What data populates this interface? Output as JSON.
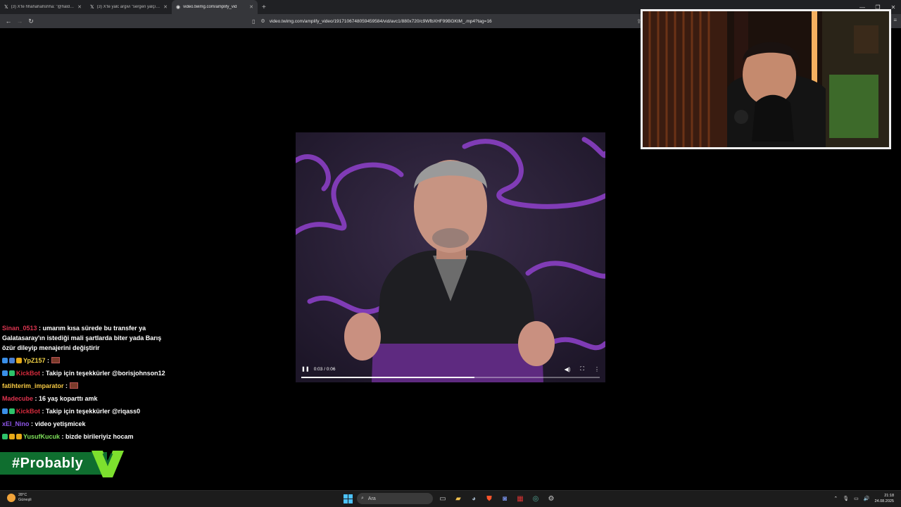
{
  "browser": {
    "tabs": [
      {
        "label": "(3) X'te hhahahahshha: \"@haldunsim",
        "icon": "x-logo-icon",
        "active": false
      },
      {
        "label": "(3) X'te yalc argivi \"sergen yalçın - bi",
        "icon": "x-logo-icon",
        "active": false
      },
      {
        "label": "video.twimg.com/amplify_vid",
        "icon": "speaker-icon",
        "active": true
      }
    ],
    "new_tab_label": "+",
    "url": "video.twimg.com/amplify_video/1917106748059459584/vid/avc1/880x720/c9WfbXHF99BGKtM_.mp4?tag=16"
  },
  "video": {
    "time": "0:03 / 0:06",
    "progress_fraction": 0.58
  },
  "chat": {
    "messages": [
      {
        "user": "Sinan_0513",
        "user_color": "#d9344f",
        "text": "umarım kısa sürede bu transfer ya Galatasaray'ın istediği mali şartlarda biter yada Barış özür dileyip menajerini değiştirir",
        "badges": [],
        "emote": false
      },
      {
        "user": "YpZ157",
        "user_color": "#f5d547",
        "text": "",
        "badges": [
          "#3a8fe8",
          "#4a7fd0",
          "#e6a817"
        ],
        "emote": true
      },
      {
        "user": "KickBot",
        "user_color": "#d42a3c",
        "text": "Takip için teşekkürler @borisjohnson12",
        "badges": [
          "#3a8fe8",
          "#2ec26a"
        ],
        "emote": false
      },
      {
        "user": "fatihterim_imparator",
        "user_color": "#f5c842",
        "text": "",
        "badges": [],
        "emote": true
      },
      {
        "user": "Madecube",
        "user_color": "#e0334e",
        "text": "16 yaş koparttı amk",
        "badges": [],
        "emote": false
      },
      {
        "user": "KickBot",
        "user_color": "#d42a3c",
        "text": "Takip için teşekkürler @riqass0",
        "badges": [
          "#3a8fe8",
          "#2ec26a"
        ],
        "emote": false
      },
      {
        "user": "xEl_Nino",
        "user_color": "#8e55e8",
        "text": "video yetişmicek",
        "badges": [],
        "emote": false
      },
      {
        "user": "YusufKucuk",
        "user_color": "#7ee05a",
        "text": "bizde birileriyiz hocam",
        "badges": [
          "#2ec26a",
          "#e6a817",
          "#e6a817"
        ],
        "emote": false
      }
    ]
  },
  "promo": {
    "text": "#Probably"
  },
  "taskbar": {
    "weather_temp": "28°C",
    "weather_desc": "Güneşli",
    "search_placeholder": "Ara",
    "time": "21:18",
    "date": "24.08.2025"
  }
}
